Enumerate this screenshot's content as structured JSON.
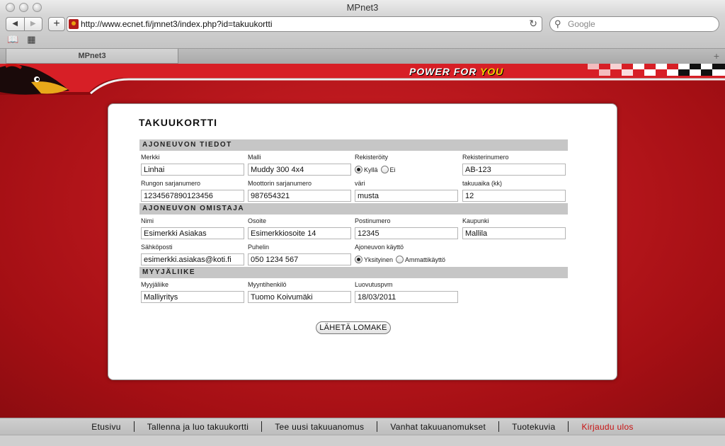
{
  "browser": {
    "window_title": "MPnet3",
    "url": "http://www.ecnet.fi/jmnet3/index.php?id=takuukortti",
    "search_placeholder": "Google",
    "tab_title": "MPnet3"
  },
  "banner": {
    "slogan_part1": "POWER ",
    "slogan_part2": "FOR ",
    "slogan_part3": "YOU"
  },
  "form": {
    "title": "TAKUUKORTTI",
    "sections": {
      "vehicle": "AJONEUVON TIEDOT",
      "owner": "AJONEUVON OMISTAJA",
      "dealer": "MYYJÄLIIKE"
    },
    "fields": {
      "merkki": {
        "label": "Merkki",
        "value": "Linhai"
      },
      "malli": {
        "label": "Malli",
        "value": "Muddy 300 4x4"
      },
      "rekisteroity": {
        "label": "Rekisteröity",
        "options": [
          "Kyllä",
          "Ei"
        ],
        "selected": "Kyllä"
      },
      "rekisterinumero": {
        "label": "Rekisterinumero",
        "value": "AB-123"
      },
      "rungon_sarjanumero": {
        "label": "Rungon sarjanumero",
        "value": "1234567890123456"
      },
      "moottorin_sarjanumero": {
        "label": "Moottorin sarjanumero",
        "value": "987654321"
      },
      "vari": {
        "label": "väri",
        "value": "musta"
      },
      "takuuaika": {
        "label": "takuuaika (kk)",
        "value": "12"
      },
      "nimi": {
        "label": "Nimi",
        "value": "Esimerkki Asiakas"
      },
      "osoite": {
        "label": "Osoite",
        "value": "Esimerkkiosoite 14"
      },
      "postinumero": {
        "label": "Postinumero",
        "value": "12345"
      },
      "kaupunki": {
        "label": "Kaupunki",
        "value": "Mallila"
      },
      "sahkoposti": {
        "label": "Sähköposti",
        "value": "esimerkki.asiakas@koti.fi"
      },
      "puhelin": {
        "label": "Puhelin",
        "value": "050 1234 567"
      },
      "kaytto": {
        "label": "Ajoneuvon käyttö",
        "options": [
          "Yksityinen",
          "Ammattikäyttö"
        ],
        "selected": "Yksityinen"
      },
      "myyjaliike": {
        "label": "Myyjäliike",
        "value": "Malliyritys"
      },
      "myyntihenkilo": {
        "label": "Myyntihenkilö",
        "value": "Tuomo Koivumäki"
      },
      "luovutuspvm": {
        "label": "Luovutuspvm",
        "value": "18/03/2011"
      }
    },
    "submit_label": "LÄHETÄ LOMAKE"
  },
  "bottom_nav": {
    "items": [
      "Etusivu",
      "Tallenna ja luo takuukortti",
      "Tee uusi takuuanomus",
      "Vanhat takuuanomukset",
      "Tuotekuvia",
      "Kirjaudu ulos"
    ]
  },
  "colors": {
    "page_red": "#c41a1f",
    "logout_red": "#c81212",
    "section_gray": "#c6c6c6"
  }
}
